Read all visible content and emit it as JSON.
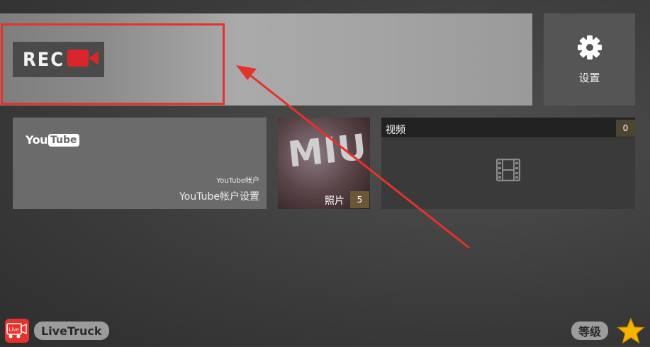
{
  "banner": {
    "rec_text": "REC"
  },
  "settings": {
    "label": "设置",
    "icon": "gear-icon"
  },
  "youtube": {
    "logo_you": "You",
    "logo_tube": "Tube",
    "account_small": "YouTube帐户",
    "account_main": "YouTube帐户设置"
  },
  "photos": {
    "thumbnail_text": "MIU",
    "label": "照片",
    "count": "5"
  },
  "videos": {
    "label": "视频",
    "count": "0",
    "icon": "film-icon"
  },
  "footer": {
    "app_name": "LiveTruck",
    "app_icon_text": "Live",
    "rate_label": "等级",
    "star_icon": "star-icon"
  },
  "colors": {
    "highlight": "#e5322b",
    "badge": "#6b5736",
    "accent_red": "#e5322b",
    "star": "#f5b400"
  }
}
